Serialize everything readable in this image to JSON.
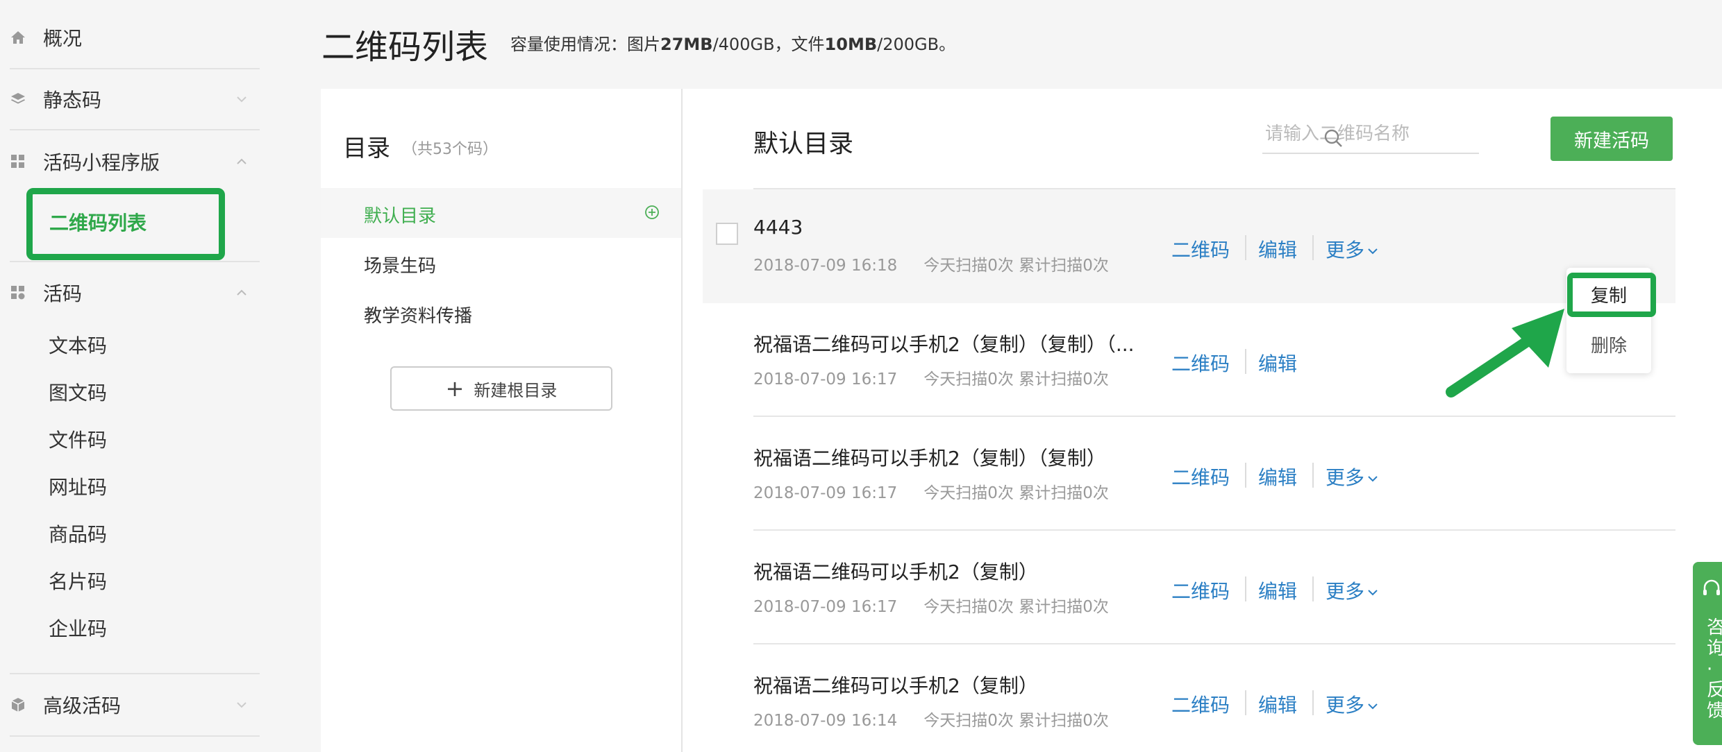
{
  "sidebar": {
    "overview": "概况",
    "static_code": "静态码",
    "miniprogram": "活码小程序版",
    "qr_list": "二维码列表",
    "dynamic": "活码",
    "dynamic_items": [
      "文本码",
      "图文码",
      "文件码",
      "网址码",
      "商品码",
      "名片码",
      "企业码"
    ],
    "advanced": "高级活码"
  },
  "header": {
    "title": "二维码列表",
    "usage_prefix": "容量使用情况：图片",
    "usage_img_used": "27MB",
    "usage_img_total": "/400GB，文件",
    "usage_file_used": "10MB",
    "usage_file_total": "/200GB。"
  },
  "catalog": {
    "title": "目录",
    "count": "（共53个码）",
    "items": [
      "默认目录",
      "场景生码",
      "教学资料传播"
    ],
    "new_root": "新建根目录"
  },
  "main": {
    "title": "默认目录",
    "search_placeholder": "请输入二维码名称",
    "new_button": "新建活码",
    "rows": [
      {
        "name": "4443",
        "time": "2018-07-09 16:18",
        "stats": "今天扫描0次 累计扫描0次"
      },
      {
        "name": "祝福语二维码可以手机2（复制）（复制）（...",
        "time": "2018-07-09 16:17",
        "stats": "今天扫描0次 累计扫描0次"
      },
      {
        "name": "祝福语二维码可以手机2（复制）（复制）",
        "time": "2018-07-09 16:17",
        "stats": "今天扫描0次 累计扫描0次"
      },
      {
        "name": "祝福语二维码可以手机2（复制）",
        "time": "2018-07-09 16:17",
        "stats": "今天扫描0次 累计扫描0次"
      },
      {
        "name": "祝福语二维码可以手机2（复制）",
        "time": "2018-07-09 16:14",
        "stats": "今天扫描0次 累计扫描0次"
      }
    ],
    "actions": {
      "qr": "二维码",
      "edit": "编辑",
      "more": "更多"
    }
  },
  "dropdown": {
    "copy": "复制",
    "delete": "删除"
  },
  "feedback": "咨询·反馈",
  "colors": {
    "brand_green": "#4caf57",
    "link_blue": "#2b7fc4",
    "highlight_green": "#1fa64a"
  }
}
